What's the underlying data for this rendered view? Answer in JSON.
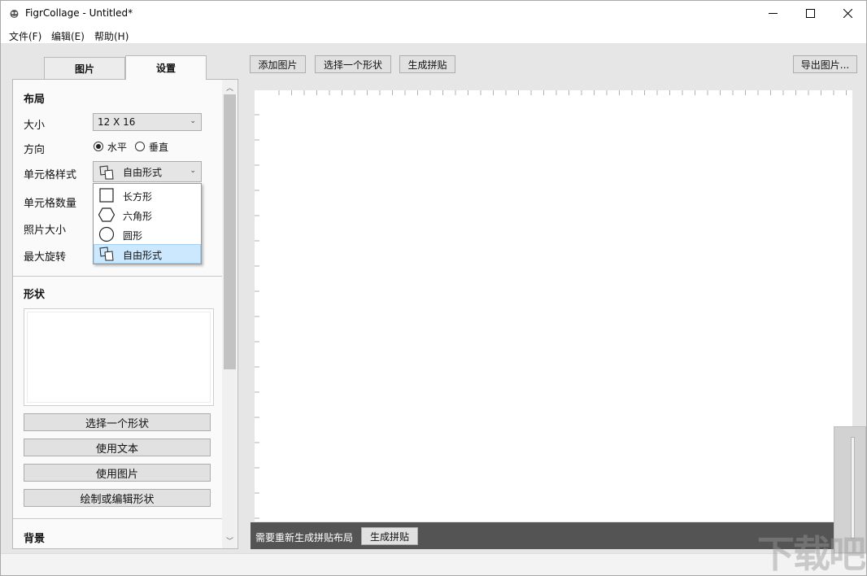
{
  "window": {
    "title": "FigrCollage - Untitled*",
    "icon": "app-logo-icon",
    "controls": [
      "minimize-icon",
      "maximize-icon",
      "close-icon"
    ]
  },
  "menu": {
    "file": "文件(F)",
    "edit": "编辑(E)",
    "help": "帮助(H)"
  },
  "tabs": {
    "pictures": "图片",
    "settings": "设置",
    "active": "settings"
  },
  "layout_section": {
    "title": "布局",
    "size_label": "大小",
    "size_value": "12 X 16",
    "orientation_label": "方向",
    "orientation_horizontal": "水平",
    "orientation_vertical": "垂直",
    "orientation_selected": "horizontal",
    "cell_style_label": "单元格样式",
    "cell_style_value": "自由形式",
    "cell_count_label": "单元格数量",
    "photo_size_label": "照片大小",
    "max_rotation_label": "最大旋转"
  },
  "cell_style_dropdown": {
    "open": true,
    "options": [
      {
        "label": "长方形",
        "icon": "rectangle-icon"
      },
      {
        "label": "六角形",
        "icon": "hexagon-icon"
      },
      {
        "label": "圆形",
        "icon": "circle-icon"
      },
      {
        "label": "自由形式",
        "icon": "freeform-icon"
      }
    ],
    "selected_index": 3
  },
  "shape_section": {
    "title": "形状",
    "buttons": {
      "select_shape": "选择一个形状",
      "use_text": "使用文本",
      "use_image": "使用图片",
      "draw_edit_shape": "绘制或编辑形状"
    }
  },
  "background_section": {
    "title": "背景"
  },
  "toolbar": {
    "add_images": "添加图片",
    "select_shape": "选择一个形状",
    "generate_collage": "生成拼贴",
    "export_image": "导出图片..."
  },
  "status": {
    "message": "需要重新生成拼贴布局",
    "button": "生成拼贴"
  },
  "watermark": "下载吧",
  "colors": {
    "window_bg": "#e6e6e6",
    "panel_bg": "#fafafa",
    "selection": "#cce8ff",
    "selection_border": "#99d1ff",
    "statusbar": "#545454"
  }
}
